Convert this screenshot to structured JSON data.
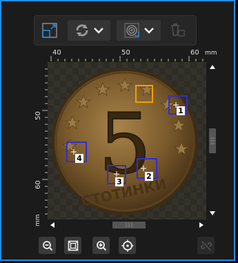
{
  "ruler": {
    "top_labels": [
      "40",
      "50",
      "60"
    ],
    "unit": "mm",
    "left_labels": [
      "50",
      "60"
    ],
    "left_unit": "mm"
  },
  "markers": [
    {
      "id": "1",
      "color": "#2f2fd0"
    },
    {
      "id": "2",
      "color": "#2f2fd0"
    },
    {
      "id": "3",
      "color": "#2f2fd0"
    },
    {
      "id": "4",
      "color": "#2f2fd0"
    }
  ],
  "highlight_color": "#f0a000",
  "accent_color": "#1e8fe6",
  "coin": {
    "digit": "5",
    "inscription": "СТОТИНКИ"
  },
  "icons": {
    "toolbar": [
      "layout-swap-icon",
      "refresh-icon",
      "chevron-down-icon",
      "spiral-icon",
      "chevron-down-icon",
      "delete-icon"
    ],
    "bottom": [
      "zoom-out-icon",
      "fit-to-view-icon",
      "zoom-in-icon",
      "target-icon",
      "link-off-icon"
    ]
  }
}
